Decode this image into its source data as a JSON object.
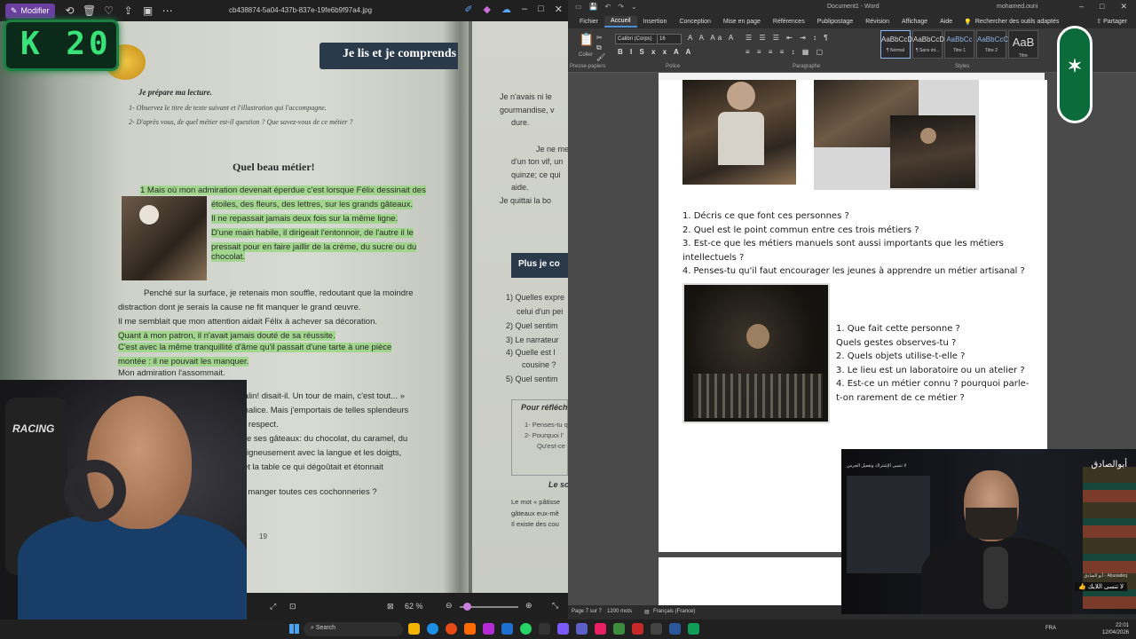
{
  "viewer": {
    "edit_label": "Modifier",
    "file_name": "cb438874-5a04-437b-837e-19fe6b9f97a4.jpg",
    "zoom": "62 %",
    "counter": "K 20",
    "headset_brand": "RACING"
  },
  "book": {
    "banner": "Je lis et je comprends",
    "prepare": "Je prépare ma lecture.",
    "q1": "1-  Observez le titre de texte suivant et l'illustration qui l'accompagne.",
    "q2": "2-  D'après vous, de quel métier est-il question ? Que savez-vous de ce métier ?",
    "title": "Quel beau métier!",
    "lines": [
      "1 Mais où mon admiration devenait éperdue c'est lorsque Félix dessinait des",
      "étoiles, des fleurs, des lettres, sur les grands gâteaux.",
      "Il ne repassait jamais deux fois sur la même ligne.",
      "D'une main habile, il dirigeait l'entonnoir, de l'autre il le",
      "pressait pour en faire jaillir de la crème, du sucre ou du",
      "chocolat.",
      "Penché sur la surface, je retenais mon souffle, redoutant que la moindre",
      "distraction dont je serais la cause ne fit manquer le grand œuvre.",
      "Il me semblait que mon attention aidait Félix à achever sa décoration.",
      "Quant à mon patron, il n'avait jamais douté de sa réussite.",
      "C'est avec la même tranquillité d'âme qu'il passait d'une tarte  à une pièce",
      "montée : il ne pouvait les manquer.",
      "Mon admiration l'assommait.",
      "i malin! disait-il. Un tour de main, c'est tout... »",
      "ni malice. Mais j'emportais de telles splendeurs",
      "e respect.",
      "e ses gâteaux: du chocolat, du caramel, du",
      "igneusement avec la langue et les doigts,",
      "et la table ce qui dégoûtait et étonnait",
      "x manger toutes ces cochonneries ?"
    ],
    "page_number": "19",
    "right_col": [
      "Je n'avais ni le",
      "gourmandise, v",
      "dure.",
      "Je ne me",
      "d'un ton vif, un",
      "quinze; ce qui",
      "aide.",
      "Je quittai la bo"
    ],
    "plus_label": "Plus je co",
    "right_questions": [
      "1) Quelles expre",
      "celui d'un pei",
      "2)  Quel sentim",
      "3)  Le narrateur",
      "4)  Quelle est l",
      "cousine ?",
      "5)  Quel sentim"
    ],
    "reflect_title": "Pour réfléch",
    "reflect_lines": [
      "1- Penses-tu q",
      "2- Pourquoi l'",
      "Qu'est-ce"
    ],
    "le_so": "Le so",
    "foot_lines": [
      "Le mot « pâtisse",
      "gâteaux eux-mê",
      "Il existe des cou"
    ]
  },
  "word": {
    "doc_title": "Document1 - Word",
    "user": "mohamed.ouni",
    "tabs": [
      "Fichier",
      "Accueil",
      "Insertion",
      "Conception",
      "Mise en page",
      "Références",
      "Publipostage",
      "Révision",
      "Affichage",
      "Aide"
    ],
    "search": "Rechercher des outils adaptés",
    "share": "Partager",
    "font_name": "Calibri (Corps)",
    "font_size": "16",
    "groups": {
      "clipboard": "Presse-papiers",
      "paste": "Coller",
      "police": "Police",
      "paragraphe": "Paragraphe",
      "styles": "Styles"
    },
    "styles": [
      {
        "preview": "AaBbCcDd",
        "name": "¶ Normal"
      },
      {
        "preview": "AaBbCcDd",
        "name": "¶ Sans int..."
      },
      {
        "preview": "AaBbCc",
        "name": "Titre 1"
      },
      {
        "preview": "AaBbCcC",
        "name": "Titre 2"
      },
      {
        "preview": "AaB",
        "name": "Titre"
      }
    ],
    "questions_a": [
      "1. Décris ce que font ces personnes ?",
      "2. Quel est le point commun entre ces trois métiers ?",
      "3. Est-ce que les métiers manuels sont aussi importants que les métiers",
      "intellectuels ?",
      "4. Penses-tu qu'il faut encourager les jeunes à apprendre un métier artisanal ?"
    ],
    "questions_b": [
      "1. Que fait cette personne ?",
      "Quels gestes observes-tu ?",
      "2. Quels objets utilise-t-elle ?",
      "3. Le lieu est un laboratoire ou un atelier ?",
      "4. Est-ce un métier connu ? pourquoi parle-",
      "t-on rarement de ce métier ?"
    ],
    "status": {
      "page": "Page 7 sur 7",
      "words": "1200 mots",
      "lang": "Français (France)"
    }
  },
  "stream": {
    "brand": "أبوالصادق",
    "top_text": "لا تنسى الإشتراك وتفعيل الجرس",
    "name": "أبو الصادق - Abusadeq",
    "cta": "لا تنسى اللايك"
  },
  "taskbar": {
    "search": "Search",
    "lang": "FRA",
    "time": "22:01",
    "date": "12/04/2026"
  },
  "colors": {
    "accent": "#6b3fa0",
    "word_accent": "#4a90d9",
    "counter": "#39e37a",
    "highlight": "#92d678"
  }
}
